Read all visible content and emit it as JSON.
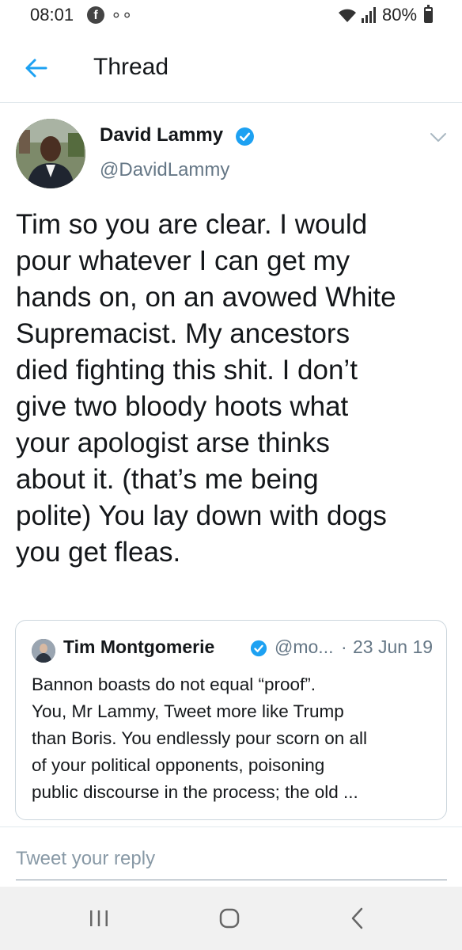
{
  "status_bar": {
    "time": "08:01",
    "battery": "80%",
    "battery_level": 0.8,
    "icons": [
      "facebook-icon",
      "voicemail-icon",
      "wifi-icon",
      "signal-icon",
      "battery-icon"
    ]
  },
  "header": {
    "title": "Thread",
    "back_icon": "arrow-left-icon",
    "accent_color": "#1da1f2"
  },
  "tweet": {
    "author_name": "David Lammy",
    "author_handle": "@DavidLammy",
    "verified": true,
    "text_lines": [
      "Tim so you are clear. I would",
      "pour whatever I can get my",
      "hands on, on an avowed White",
      "Supremacist. My ancestors",
      "died fighting this shit. I don’t",
      "give two bloody hoots what",
      "your apologist arse thinks",
      "about it. (that’s me being",
      "polite) You lay down with dogs",
      "you get fleas."
    ]
  },
  "quoted_tweet": {
    "author_name": "Tim Montgomerie",
    "author_handle": "@mo...",
    "separator": "·",
    "date": "23 Jun 19",
    "verified": true,
    "text_lines": [
      "Bannon boasts do not equal “proof”.",
      "You, Mr Lammy, Tweet more like Trump",
      "than Boris. You endlessly pour scorn on all",
      "of your political opponents, poisoning",
      "public discourse in the process; the old ..."
    ]
  },
  "reply": {
    "placeholder": "Tweet your reply",
    "value": ""
  },
  "nav_bar": {
    "buttons": [
      "recent-apps-icon",
      "home-icon",
      "back-icon"
    ]
  },
  "colors": {
    "verified_blue": "#1da1f2",
    "secondary_text": "#657786",
    "border": "#e1e8ed"
  }
}
